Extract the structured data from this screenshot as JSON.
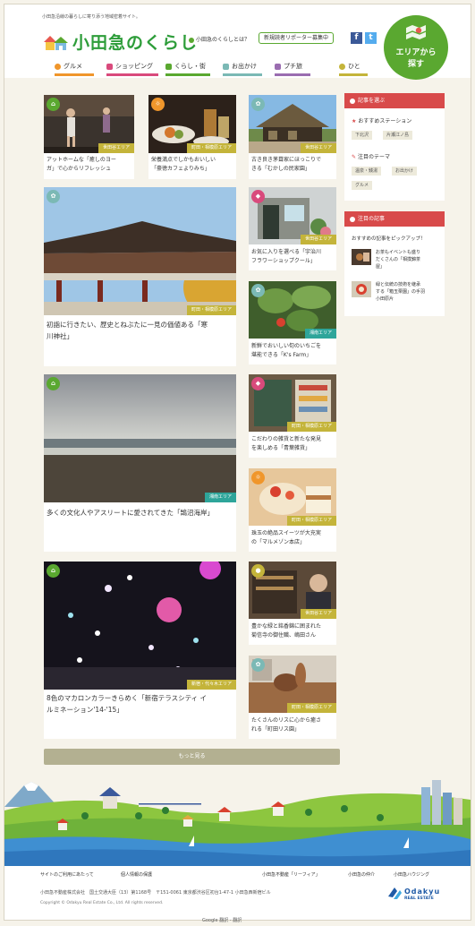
{
  "header": {
    "tagline": "小田急沿線の暮らしに寄り添う地域密着サイト。",
    "logo_text": "小田急のくらし",
    "about_link": "小田急のくらしとは？",
    "recruit_label": "新規読者リポーター募集中",
    "facebook_label": "f",
    "twitter_label": "t",
    "area_button": {
      "line1": "エリアから",
      "line2": "探す"
    }
  },
  "nav": {
    "items": [
      {
        "label": "グルメ",
        "color": "#f0962b"
      },
      {
        "label": "ショッピング",
        "color": "#d94a7c"
      },
      {
        "label": "くらし・街",
        "color": "#5aa830"
      },
      {
        "label": "お出かけ",
        "color": "#7bb9b5"
      },
      {
        "label": "プチ旅",
        "color": "#9a6db0"
      },
      {
        "label": "ひと",
        "color": "#c4b43a"
      }
    ]
  },
  "cards": [
    {
      "caption": [
        "アットホームな「癒しのヨー",
        "ガ」で心からリフレッシュ"
      ],
      "area": "世田谷エリア",
      "category": "くらし・街"
    },
    {
      "caption": [
        "栄養満点でしかもおいしい",
        "「豪徳カフェよりみち」"
      ],
      "area": "町田・相模原エリア",
      "category": "グルメ"
    },
    {
      "caption": [
        "古き良き茅葺家にほっこりで",
        "きる「むかしの民家園」"
      ],
      "area": "世田谷エリア",
      "category": "お出かけ"
    },
    {
      "caption": [
        "初詣に行きたい、歴史とねぶたに一見の価値ある「寒",
        "川神社」"
      ],
      "area": "町田・相模原エリア",
      "category": "お出かけ"
    },
    {
      "caption": [
        "お気に入りを選べる「宇治川",
        "フラワーショップクール」"
      ],
      "area": "世田谷エリア",
      "category": "ショッピング"
    },
    {
      "caption": [
        "新鮮でおいしい旬のいちごを",
        "堪能できる「K's Farm」"
      ],
      "area": "湘南エリア",
      "category": "お出かけ"
    },
    {
      "caption": [
        "多くの文化人やアスリートに愛されてきた「鵠沼海岸」"
      ],
      "area": "湘南エリア",
      "category": "くらし・街"
    },
    {
      "caption": [
        "こだわりの雑貨と新たな発見",
        "を楽しめる「青葉雑貨」"
      ],
      "area": "町田・相模原エリア",
      "category": "ショッピング"
    },
    {
      "caption": [
        "珠玉の絶品スイーツが大充実",
        "の「マルメゾン本店」"
      ],
      "area": "町田・相模原エリア",
      "category": "グルメ"
    },
    {
      "caption": [
        "8色のマカロンカラーきらめく「新宿テラスシティ イ",
        "ルミネーション'14-'15」"
      ],
      "area": "新宿・代々木エリア",
      "category": "くらし・街"
    },
    {
      "caption": [
        "豊かな緑と銘香錦に囲まれた",
        "菊信寺の御住職、嶋田さん"
      ],
      "area": "世田谷エリア",
      "category": "ひと"
    },
    {
      "caption": [
        "たくさんのリスに心から癒さ",
        "れる「町田リス園」"
      ],
      "area": "町田・相模原エリア",
      "category": "お出かけ"
    }
  ],
  "more_button": "もっと見る",
  "sidebar": {
    "choose_title": "記事を選ぶ",
    "station_heading": "おすすめステーション",
    "stations": [
      "下北沢",
      "片瀬江ノ島"
    ],
    "theme_heading": "注目のテーマ",
    "themes": [
      "温泉・銭湯",
      "お出かけ",
      "グルメ"
    ],
    "featured_title": "注目の記事",
    "featured_sub": "おすすめの記事をピックアップ！",
    "featured": [
      {
        "text": [
          "お茶もイベントも盛り",
          "だくさんの「相撲錦茶",
          "屋」"
        ]
      },
      {
        "text": [
          "緑と伝統の技術を継承",
          "する「箱玉栗園」の手羽",
          "小田原片"
        ]
      }
    ]
  },
  "footer": {
    "links_left": [
      "サイトのご利用にあたって",
      "個人情報の保護"
    ],
    "links_right": [
      "小田急不動産「リーフィア」",
      "小田急の仲介",
      "小田急ハウジング"
    ],
    "address": "小田急不動産株式会社　国土交通大臣（13）第1168号　〒151-0061 東京都渋谷区初台1-47-1 小田急西新宿ビル",
    "copyright": "Copyright © Odakyu Real Estate Co., Ltd. All rights reserved.",
    "brand_name": "Odakyu",
    "brand_sub": "REAL ESTATE"
  },
  "google_translate": "Google 翻訳 - 翻訳"
}
